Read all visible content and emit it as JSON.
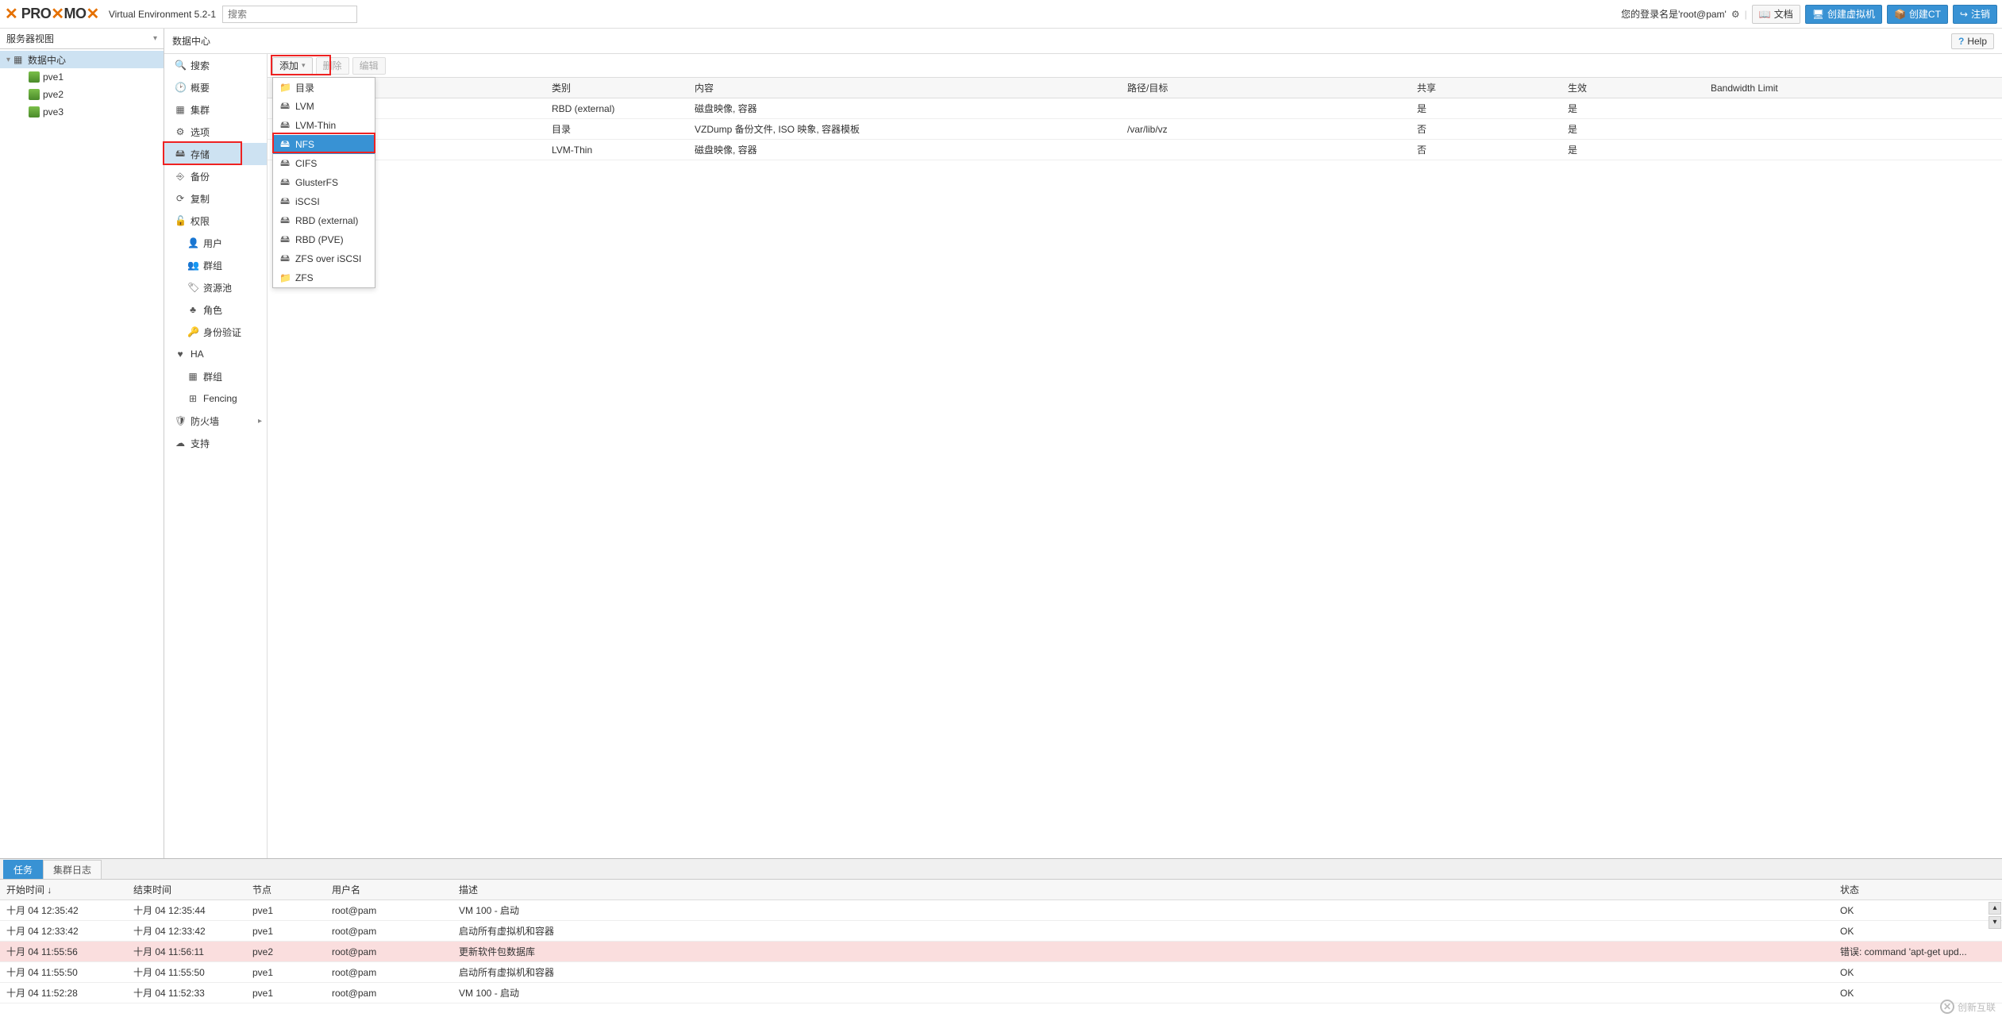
{
  "header": {
    "brand": "PROXMOX",
    "version": "Virtual Environment 5.2-1",
    "search_placeholder": "搜索",
    "login_info": "您的登录名是'root@pam'",
    "doc_label": "文档",
    "create_vm_label": "创建虚拟机",
    "create_ct_label": "创建CT",
    "logout_label": "注销"
  },
  "leftView": {
    "label": "服务器视图"
  },
  "tree": {
    "root": "数据中心",
    "nodes": [
      "pve1",
      "pve2",
      "pve3"
    ]
  },
  "crumb": {
    "title": "数据中心",
    "help": "Help"
  },
  "config": {
    "items": [
      {
        "icon": "🔍",
        "label": "搜索"
      },
      {
        "icon": "🕑",
        "label": "概要"
      },
      {
        "icon": "▦",
        "label": "集群"
      },
      {
        "icon": "⚙",
        "label": "选项"
      },
      {
        "icon": "🖴",
        "label": "存储",
        "selected": true
      },
      {
        "icon": "⎆",
        "label": "备份"
      },
      {
        "icon": "⟳",
        "label": "复制"
      },
      {
        "icon": "🔓",
        "label": "权限",
        "expandable": true
      },
      {
        "icon": "👤",
        "label": "用户",
        "sub": true
      },
      {
        "icon": "👥",
        "label": "群组",
        "sub": true
      },
      {
        "icon": "🏷",
        "label": "资源池",
        "sub": true
      },
      {
        "icon": "♣",
        "label": "角色",
        "sub": true
      },
      {
        "icon": "🔑",
        "label": "身份验证",
        "sub": true
      },
      {
        "icon": "♥",
        "label": "HA",
        "expandable": true
      },
      {
        "icon": "▦",
        "label": "群组",
        "sub": true
      },
      {
        "icon": "⊞",
        "label": "Fencing",
        "sub": true
      },
      {
        "icon": "🛡",
        "label": "防火墙",
        "expandable": true,
        "arrow": true
      },
      {
        "icon": "☁",
        "label": "支持"
      }
    ]
  },
  "toolbar": {
    "add": "添加",
    "remove": "删除",
    "edit": "编辑"
  },
  "addMenu": [
    {
      "icon": "📁",
      "label": "目录"
    },
    {
      "icon": "🖴",
      "label": "LVM"
    },
    {
      "icon": "🖴",
      "label": "LVM-Thin"
    },
    {
      "icon": "🖴",
      "label": "NFS",
      "selected": true
    },
    {
      "icon": "🖴",
      "label": "CIFS"
    },
    {
      "icon": "🖴",
      "label": "GlusterFS"
    },
    {
      "icon": "🖴",
      "label": "iSCSI"
    },
    {
      "icon": "🖴",
      "label": "RBD (external)"
    },
    {
      "icon": "🖴",
      "label": "RBD (PVE)"
    },
    {
      "icon": "🖴",
      "label": "ZFS over iSCSI"
    },
    {
      "icon": "📁",
      "label": "ZFS"
    }
  ],
  "storageTable": {
    "headers": {
      "id": "",
      "type": "类别",
      "content": "内容",
      "path": "路径/目标",
      "shared": "共享",
      "enabled": "生效",
      "bw": "Bandwidth Limit"
    },
    "rows": [
      {
        "id": "",
        "type": "RBD (external)",
        "content": "磁盘映像, 容器",
        "path": "",
        "shared": "是",
        "enabled": "是",
        "bw": ""
      },
      {
        "id": "",
        "type": "目录",
        "content": "VZDump 备份文件, ISO 映象, 容器模板",
        "path": "/var/lib/vz",
        "shared": "否",
        "enabled": "是",
        "bw": ""
      },
      {
        "id": "",
        "type": "LVM-Thin",
        "content": "磁盘映像, 容器",
        "path": "",
        "shared": "否",
        "enabled": "是",
        "bw": ""
      }
    ]
  },
  "logTabs": {
    "tasks": "任务",
    "cluster": "集群日志"
  },
  "logTable": {
    "headers": {
      "start": "开始时间 ↓",
      "end": "结束时间",
      "node": "节点",
      "user": "用户名",
      "desc": "描述",
      "status": "状态"
    },
    "rows": [
      {
        "start": "十月 04 12:35:42",
        "end": "十月 04 12:35:44",
        "node": "pve1",
        "user": "root@pam",
        "desc": "VM 100 - 启动",
        "status": "OK"
      },
      {
        "start": "十月 04 12:33:42",
        "end": "十月 04 12:33:42",
        "node": "pve1",
        "user": "root@pam",
        "desc": "启动所有虚拟机和容器",
        "status": "OK"
      },
      {
        "start": "十月 04 11:55:56",
        "end": "十月 04 11:56:11",
        "node": "pve2",
        "user": "root@pam",
        "desc": "更新软件包数据库",
        "status": "错误: command 'apt-get upd...",
        "err": true
      },
      {
        "start": "十月 04 11:55:50",
        "end": "十月 04 11:55:50",
        "node": "pve1",
        "user": "root@pam",
        "desc": "启动所有虚拟机和容器",
        "status": "OK"
      },
      {
        "start": "十月 04 11:52:28",
        "end": "十月 04 11:52:33",
        "node": "pve1",
        "user": "root@pam",
        "desc": "VM 100 - 启动",
        "status": "OK"
      }
    ]
  },
  "watermark": "创新互联"
}
